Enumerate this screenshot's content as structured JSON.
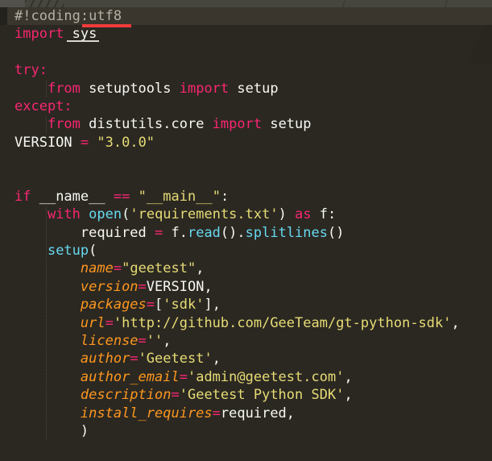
{
  "editor": {
    "language": "python",
    "palette": {
      "background": "#2b2822",
      "strip": "#46453e",
      "strip-left": "#52514b",
      "line-highlight": "#3a362d",
      "gutter-mark": "#24221c",
      "plain": "#f8f8f2",
      "comment": "#b3b1a5",
      "keyword": "#f92672",
      "string": "#e6db74",
      "builtin": "#66d9ef",
      "param": "#fd971f",
      "error": "#f23b3b",
      "light-underline": "#d9d7cf"
    },
    "lines": [
      {
        "current": true,
        "marks": [
          "gutter-block",
          "red-error-bar"
        ],
        "segments": [
          {
            "text": "#!coding:utf8",
            "style": "comment"
          }
        ]
      },
      {
        "marks": [
          "light-underline"
        ],
        "segments": [
          {
            "text": "import",
            "style": "keyword"
          },
          {
            "text": " sys",
            "style": "plain"
          }
        ]
      },
      {
        "segments": []
      },
      {
        "segments": [
          {
            "text": "try:",
            "style": "keyword"
          }
        ]
      },
      {
        "segments": [
          {
            "text": "    ",
            "style": "plain"
          },
          {
            "text": "from",
            "style": "keyword"
          },
          {
            "text": " setuptools ",
            "style": "plain"
          },
          {
            "text": "import",
            "style": "keyword"
          },
          {
            "text": " setup",
            "style": "plain"
          }
        ]
      },
      {
        "segments": [
          {
            "text": "except:",
            "style": "keyword"
          }
        ]
      },
      {
        "segments": [
          {
            "text": "    ",
            "style": "plain"
          },
          {
            "text": "from",
            "style": "keyword"
          },
          {
            "text": " distutils.core ",
            "style": "plain"
          },
          {
            "text": "import",
            "style": "keyword"
          },
          {
            "text": " setup",
            "style": "plain"
          }
        ]
      },
      {
        "segments": [
          {
            "text": "VERSION ",
            "style": "plain"
          },
          {
            "text": "=",
            "style": "operator"
          },
          {
            "text": " ",
            "style": "plain"
          },
          {
            "text": "\"3.0.0\"",
            "style": "string"
          }
        ]
      },
      {
        "segments": []
      },
      {
        "segments": []
      },
      {
        "segments": [
          {
            "text": "if",
            "style": "keyword"
          },
          {
            "text": " __name__ ",
            "style": "plain"
          },
          {
            "text": "==",
            "style": "operator"
          },
          {
            "text": " ",
            "style": "plain"
          },
          {
            "text": "\"__main__\"",
            "style": "string"
          },
          {
            "text": ":",
            "style": "plain"
          }
        ]
      },
      {
        "segments": [
          {
            "text": "    ",
            "style": "plain"
          },
          {
            "text": "with",
            "style": "keyword"
          },
          {
            "text": " ",
            "style": "plain"
          },
          {
            "text": "open",
            "style": "builtin"
          },
          {
            "text": "(",
            "style": "plain"
          },
          {
            "text": "'requirements.txt'",
            "style": "string"
          },
          {
            "text": ") ",
            "style": "plain"
          },
          {
            "text": "as",
            "style": "keyword"
          },
          {
            "text": " f:",
            "style": "plain"
          }
        ]
      },
      {
        "segments": [
          {
            "text": "        required ",
            "style": "plain"
          },
          {
            "text": "=",
            "style": "operator"
          },
          {
            "text": " f.",
            "style": "plain"
          },
          {
            "text": "read",
            "style": "builtin"
          },
          {
            "text": "().",
            "style": "plain"
          },
          {
            "text": "splitlines",
            "style": "builtin"
          },
          {
            "text": "()",
            "style": "plain"
          }
        ]
      },
      {
        "segments": [
          {
            "text": "    ",
            "style": "plain"
          },
          {
            "text": "setup",
            "style": "builtin"
          },
          {
            "text": "(",
            "style": "plain"
          }
        ]
      },
      {
        "segments": [
          {
            "text": "        ",
            "style": "plain"
          },
          {
            "text": "name",
            "style": "param"
          },
          {
            "text": "=",
            "style": "operator"
          },
          {
            "text": "\"geetest\"",
            "style": "string"
          },
          {
            "text": ",",
            "style": "plain"
          }
        ]
      },
      {
        "segments": [
          {
            "text": "        ",
            "style": "plain"
          },
          {
            "text": "version",
            "style": "param"
          },
          {
            "text": "=",
            "style": "operator"
          },
          {
            "text": "VERSION,",
            "style": "plain"
          }
        ]
      },
      {
        "segments": [
          {
            "text": "        ",
            "style": "plain"
          },
          {
            "text": "packages",
            "style": "param"
          },
          {
            "text": "=",
            "style": "operator"
          },
          {
            "text": "[",
            "style": "plain"
          },
          {
            "text": "'sdk'",
            "style": "string"
          },
          {
            "text": "],",
            "style": "plain"
          }
        ]
      },
      {
        "segments": [
          {
            "text": "        ",
            "style": "plain"
          },
          {
            "text": "url",
            "style": "param"
          },
          {
            "text": "=",
            "style": "operator"
          },
          {
            "text": "'http://github.com/GeeTeam/gt-python-sdk'",
            "style": "string"
          },
          {
            "text": ",",
            "style": "plain"
          }
        ]
      },
      {
        "segments": [
          {
            "text": "        ",
            "style": "plain"
          },
          {
            "text": "license",
            "style": "param"
          },
          {
            "text": "=",
            "style": "operator"
          },
          {
            "text": "''",
            "style": "string"
          },
          {
            "text": ",",
            "style": "plain"
          }
        ]
      },
      {
        "segments": [
          {
            "text": "        ",
            "style": "plain"
          },
          {
            "text": "author",
            "style": "param"
          },
          {
            "text": "=",
            "style": "operator"
          },
          {
            "text": "'Geetest'",
            "style": "string"
          },
          {
            "text": ",",
            "style": "plain"
          }
        ]
      },
      {
        "segments": [
          {
            "text": "        ",
            "style": "plain"
          },
          {
            "text": "author_email",
            "style": "param"
          },
          {
            "text": "=",
            "style": "operator"
          },
          {
            "text": "'admin@geetest.com'",
            "style": "string"
          },
          {
            "text": ",",
            "style": "plain"
          }
        ]
      },
      {
        "segments": [
          {
            "text": "        ",
            "style": "plain"
          },
          {
            "text": "description",
            "style": "param"
          },
          {
            "text": "=",
            "style": "operator"
          },
          {
            "text": "'Geetest Python SDK'",
            "style": "string"
          },
          {
            "text": ",",
            "style": "plain"
          }
        ]
      },
      {
        "segments": [
          {
            "text": "        ",
            "style": "plain"
          },
          {
            "text": "install_requires",
            "style": "param"
          },
          {
            "text": "=",
            "style": "operator"
          },
          {
            "text": "required,",
            "style": "plain"
          }
        ]
      },
      {
        "segments": [
          {
            "text": "        )",
            "style": "plain"
          }
        ]
      }
    ]
  }
}
